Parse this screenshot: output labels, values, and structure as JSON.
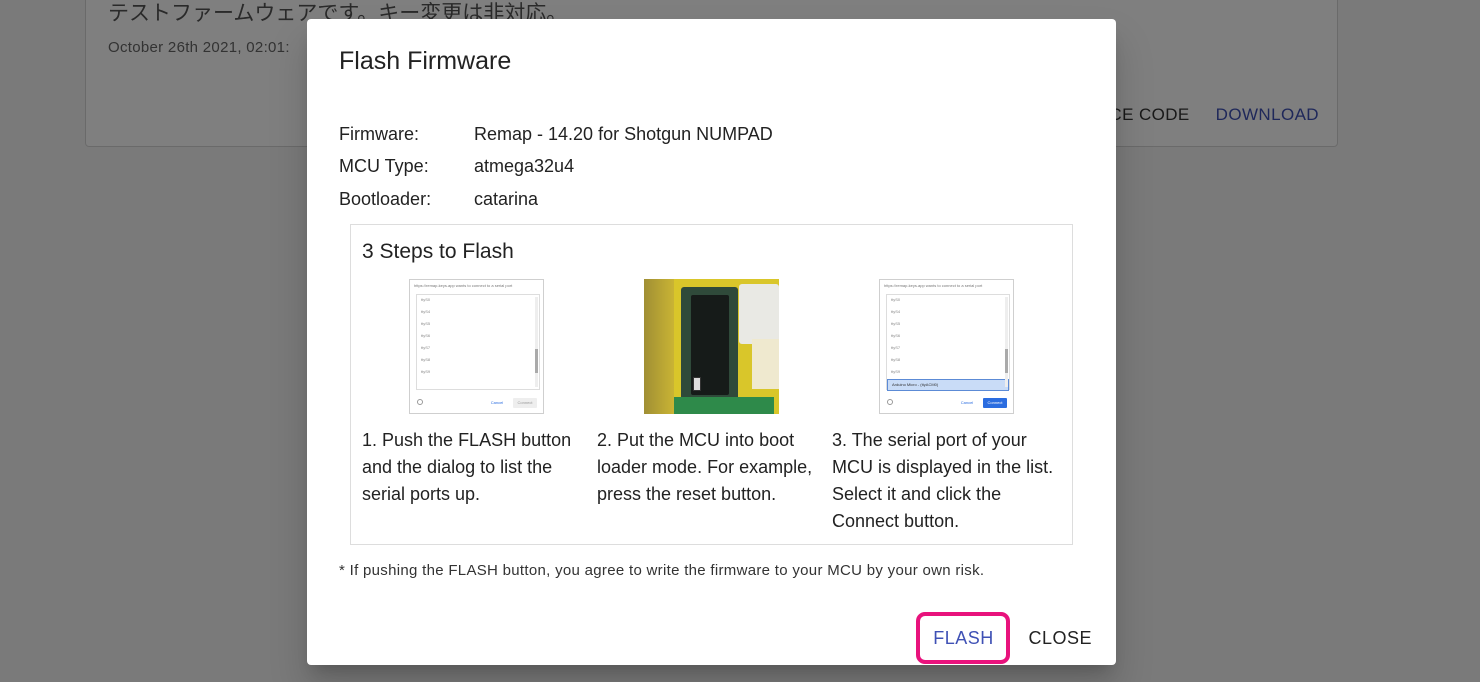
{
  "background": {
    "description": "テストファームウェアです。キー変更は非対応。",
    "date": "October 26th 2021, 02:01:",
    "source_code_label": "RCE CODE",
    "download_label": "DOWNLOAD"
  },
  "dialog": {
    "title": "Flash Firmware",
    "info": [
      {
        "label": "Firmware:",
        "value": "Remap - 14.20 for Shotgun NUMPAD"
      },
      {
        "label": "MCU Type:",
        "value": "atmega32u4"
      },
      {
        "label": "Bootloader:",
        "value": "catarina"
      }
    ],
    "steps_title": "3 Steps to Flash",
    "steps": [
      {
        "text": "1. Push the FLASH button and the dialog to list the serial ports up."
      },
      {
        "text": "2. Put the MCU into boot loader mode. For example, press the reset button."
      },
      {
        "text": "3. The serial port of your MCU is displayed in the list. Select it and click the Connect button."
      }
    ],
    "note": "* If pushing the FLASH button, you agree to write the firmware to your MCU by your own risk.",
    "flash_label": "FLASH",
    "close_label": "CLOSE"
  },
  "thumbnail": {
    "header": "https://remap-keys.app wants to connect to a serial port",
    "ports": [
      "ttyS0",
      "ttyS4",
      "ttyS5",
      "ttyS6",
      "ttyS7",
      "ttyS8",
      "ttyS9"
    ],
    "selected_port": "Arduino Micro - (ttyACM0)",
    "cancel": "Cancel",
    "connect": "Connect"
  },
  "colors": {
    "accent": "#3f51b5",
    "highlight": "#e8127c"
  }
}
